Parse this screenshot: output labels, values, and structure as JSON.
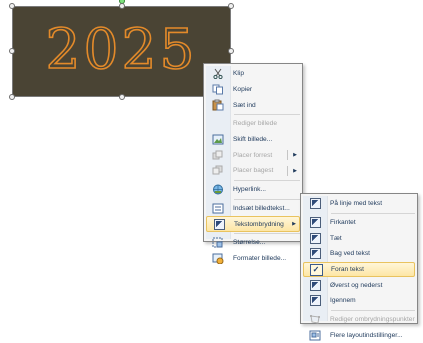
{
  "picture": {
    "text": "2025",
    "text_color": "#e38a2a",
    "background": "#4a4434"
  },
  "context_menu": {
    "items": [
      {
        "label": "Klip",
        "icon": "scissors-icon",
        "disabled": false
      },
      {
        "label": "Kopier",
        "icon": "copy-icon",
        "disabled": false
      },
      {
        "label": "Sæt ind",
        "icon": "paste-icon",
        "disabled": false
      },
      {
        "label": "Rediger billede",
        "icon": "",
        "disabled": true
      },
      {
        "label": "Skift billede...",
        "icon": "change-picture-icon",
        "disabled": false
      },
      {
        "label": "Placer forrest",
        "icon": "bring-forward-icon",
        "disabled": true
      },
      {
        "label": "Placer bagest",
        "icon": "send-backward-icon",
        "disabled": true
      },
      {
        "label": "Hyperlink...",
        "icon": "hyperlink-icon",
        "disabled": false
      },
      {
        "label": "Indsæt billedtekst...",
        "icon": "caption-icon",
        "disabled": false
      },
      {
        "label": "Tekstombrydning",
        "icon": "text-wrap-icon",
        "disabled": false
      },
      {
        "label": "Størrelse...",
        "icon": "size-icon",
        "disabled": false
      },
      {
        "label": "Formater billede...",
        "icon": "format-picture-icon",
        "disabled": false
      }
    ]
  },
  "wrap_submenu": {
    "items": [
      {
        "label": "På linje med tekst",
        "disabled": false
      },
      {
        "label": "Firkantet",
        "disabled": false
      },
      {
        "label": "Tæt",
        "disabled": false
      },
      {
        "label": "Bag ved tekst",
        "disabled": false
      },
      {
        "label": "Foran tekst",
        "disabled": false
      },
      {
        "label": "Øverst og nederst",
        "disabled": false
      },
      {
        "label": "Igennem",
        "disabled": false
      },
      {
        "label": "Rediger ombrydningspunkter",
        "disabled": true
      },
      {
        "label": "Flere layoutindstillinger...",
        "disabled": false
      }
    ],
    "checked_item": "Foran tekst"
  },
  "colors": {
    "menu_text": "#1e395b",
    "highlight": "#fde6a5",
    "disabled_text": "#a6a6a6"
  }
}
